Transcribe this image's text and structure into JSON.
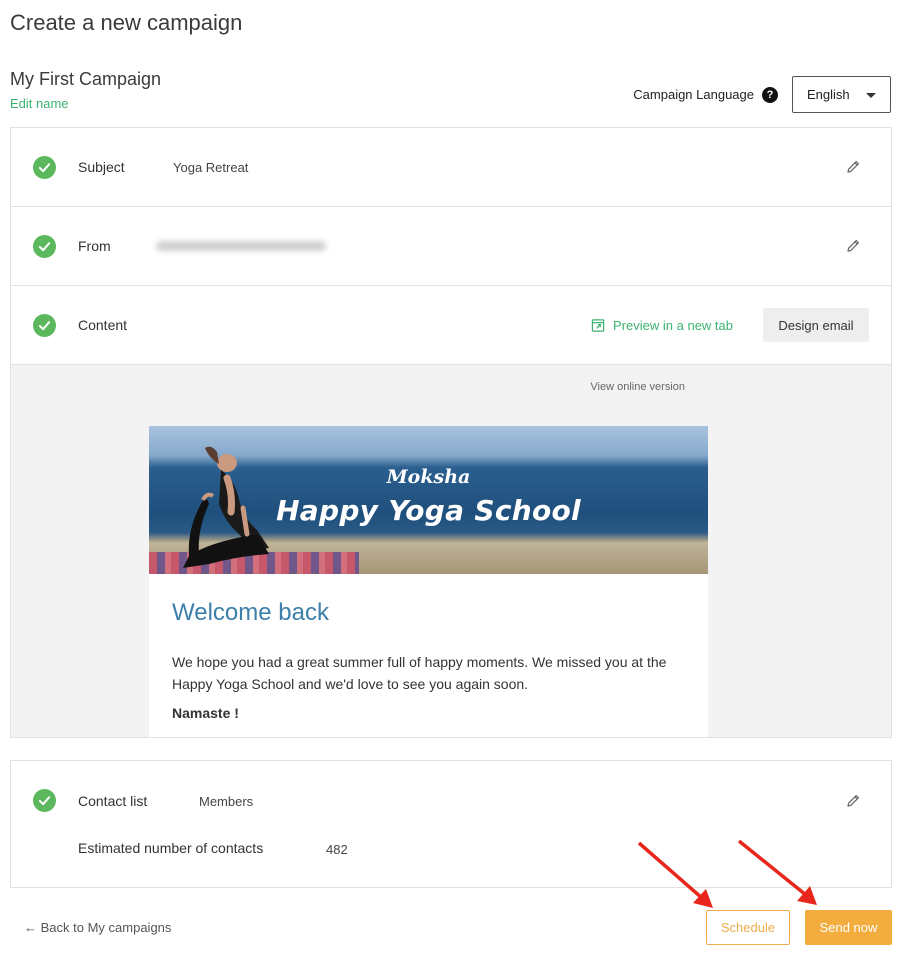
{
  "page": {
    "title": "Create a new campaign"
  },
  "campaign": {
    "name": "My First Campaign",
    "edit_name_label": "Edit name",
    "language_label": "Campaign Language",
    "language_value": "English"
  },
  "rows": {
    "subject": {
      "label": "Subject",
      "value": "Yoga Retreat"
    },
    "from": {
      "label": "From"
    },
    "content": {
      "label": "Content",
      "preview_label": "Preview in a new tab",
      "design_label": "Design email"
    }
  },
  "email": {
    "view_online": "View online version",
    "brand_small": "Moksha",
    "brand_big": "Happy Yoga School",
    "heading": "Welcome back",
    "body": "We hope you had a great summer full of happy moments. We missed you at the Happy Yoga School and we'd love to see you again soon.",
    "sign_off": "Namaste !"
  },
  "contacts": {
    "label": "Contact list",
    "value": "Members",
    "estimated_label": "Estimated number of contacts",
    "estimated_value": "482"
  },
  "footer": {
    "back_label": "Back to My campaigns",
    "back_arrow": "←",
    "schedule_label": "Schedule",
    "send_label": "Send now"
  },
  "colors": {
    "accent_green": "#3cb371",
    "check_green": "#5cb85c",
    "send_orange": "#f3ad3f",
    "annotation_red": "#e8261b",
    "heading_blue": "#3d7fab"
  },
  "icons": {
    "help": "help-icon",
    "check": "check-icon",
    "edit": "pencil-icon",
    "preview": "external-preview-icon",
    "dropdown": "chevron-down-icon"
  }
}
